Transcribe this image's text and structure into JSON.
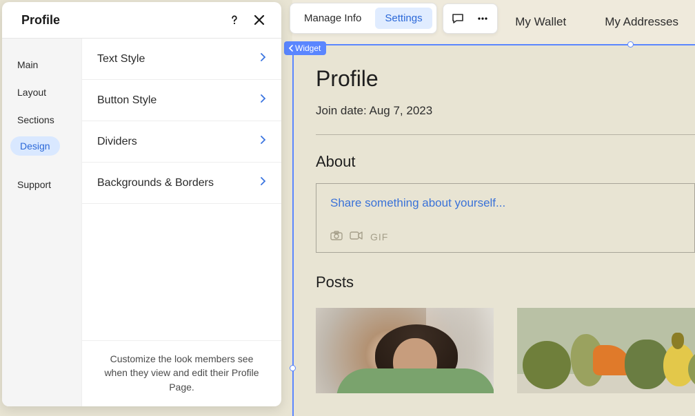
{
  "panel": {
    "title": "Profile",
    "footer": "Customize the look members see when they view and edit their Profile Page."
  },
  "sidebar": {
    "items": [
      {
        "label": "Main"
      },
      {
        "label": "Layout"
      },
      {
        "label": "Sections"
      },
      {
        "label": "Design"
      },
      {
        "label": "Support"
      }
    ]
  },
  "design_list": {
    "items": [
      {
        "label": "Text Style"
      },
      {
        "label": "Button Style"
      },
      {
        "label": "Dividers"
      },
      {
        "label": "Backgrounds & Borders"
      }
    ]
  },
  "toolbar": {
    "manage": "Manage Info",
    "settings": "Settings"
  },
  "top_tabs": {
    "wallet": "My Wallet",
    "addresses": "My Addresses"
  },
  "widget": {
    "tag": "Widget"
  },
  "profile": {
    "title": "Profile",
    "join": "Join date: Aug 7, 2023",
    "about_heading": "About",
    "about_placeholder": "Share something about yourself...",
    "gif_label": "GIF",
    "posts_heading": "Posts"
  },
  "colors": {
    "accent": "#5a86ff",
    "link": "#2b68d8"
  }
}
